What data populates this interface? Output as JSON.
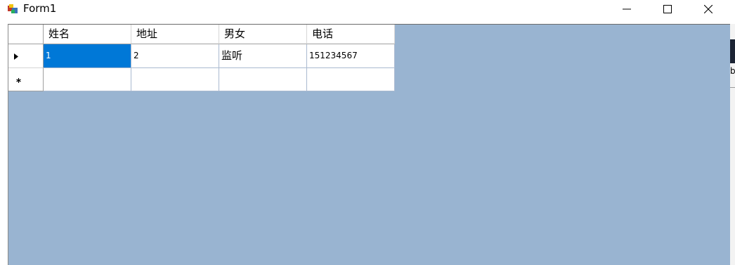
{
  "window": {
    "title": "Form1",
    "icon": "winforms-app-icon",
    "controls": [
      "minimize-icon",
      "maximize-icon",
      "close-icon"
    ]
  },
  "grid": {
    "columns": [
      "姓名",
      "地址",
      "男女",
      "电话"
    ],
    "rows": [
      {
        "indicator": "current-row-arrow-icon",
        "cells": [
          "1",
          "2",
          "监听",
          "151234567"
        ]
      },
      {
        "indicator": "new-row-asterisk-icon",
        "cells": [
          "",
          "",
          "",
          ""
        ]
      }
    ],
    "selected_cell": "row 1, 姓名"
  },
  "colors": {
    "client_background": "#99b4d1",
    "selection": "#0078d7"
  },
  "background_text": "b"
}
